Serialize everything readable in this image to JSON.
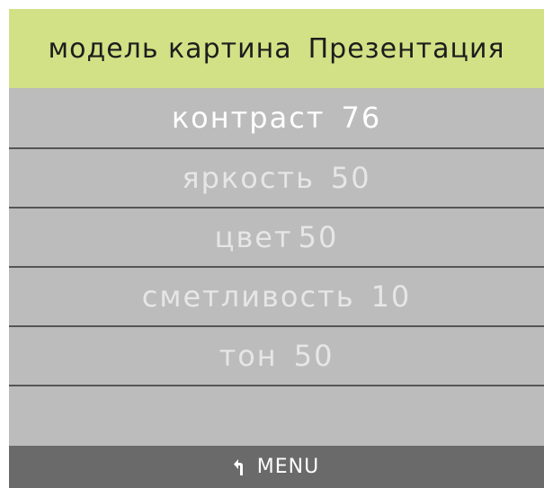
{
  "header": {
    "mode_label": "модель картина",
    "mode_value": "Презентация"
  },
  "settings": [
    {
      "label": "контраст",
      "value": "76",
      "selected": true
    },
    {
      "label": "яркость",
      "value": "50",
      "selected": false
    },
    {
      "label": "цвет",
      "value": "50",
      "selected": false
    },
    {
      "label": "сметливость",
      "value": "10",
      "selected": false
    },
    {
      "label": "тон",
      "value": "50",
      "selected": false
    }
  ],
  "footer": {
    "icon": "return-arrow-icon",
    "label": "MENU"
  },
  "colors": {
    "header_bg": "#d2e185",
    "panel_bg": "#bcbcbc",
    "footer_bg": "#6a6a6a",
    "divider": "#555555"
  }
}
